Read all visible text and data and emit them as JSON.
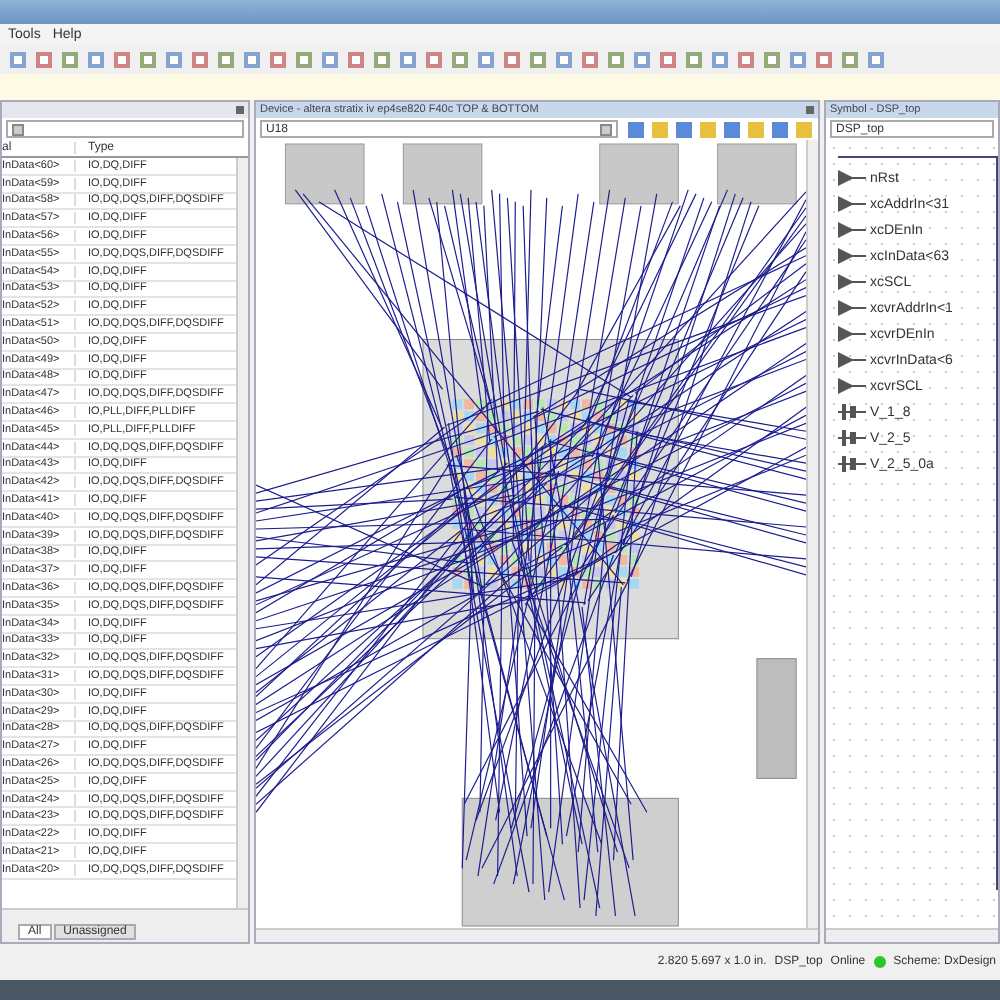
{
  "menu": [
    "Tools",
    "Help"
  ],
  "pin_panel": {
    "column_1": "al",
    "column_2": "Type",
    "tabs": [
      {
        "label": "All",
        "selected": true
      },
      {
        "label": "Unassigned",
        "selected": false
      }
    ],
    "rows": [
      {
        "signal": "InData<60>",
        "type": "IO,DQ,DIFF"
      },
      {
        "signal": "InData<59>",
        "type": "IO,DQ,DIFF"
      },
      {
        "signal": "InData<58>",
        "type": "IO,DQ,DQS,DIFF,DQSDIFF"
      },
      {
        "signal": "InData<57>",
        "type": "IO,DQ,DIFF"
      },
      {
        "signal": "InData<56>",
        "type": "IO,DQ,DIFF"
      },
      {
        "signal": "InData<55>",
        "type": "IO,DQ,DQS,DIFF,DQSDIFF"
      },
      {
        "signal": "InData<54>",
        "type": "IO,DQ,DIFF"
      },
      {
        "signal": "InData<53>",
        "type": "IO,DQ,DIFF"
      },
      {
        "signal": "InData<52>",
        "type": "IO,DQ,DIFF"
      },
      {
        "signal": "InData<51>",
        "type": "IO,DQ,DQS,DIFF,DQSDIFF"
      },
      {
        "signal": "InData<50>",
        "type": "IO,DQ,DIFF"
      },
      {
        "signal": "InData<49>",
        "type": "IO,DQ,DIFF"
      },
      {
        "signal": "InData<48>",
        "type": "IO,DQ,DIFF"
      },
      {
        "signal": "InData<47>",
        "type": "IO,DQ,DQS,DIFF,DQSDIFF"
      },
      {
        "signal": "InData<46>",
        "type": "IO,PLL,DIFF,PLLDIFF"
      },
      {
        "signal": "InData<45>",
        "type": "IO,PLL,DIFF,PLLDIFF"
      },
      {
        "signal": "InData<44>",
        "type": "IO,DQ,DQS,DIFF,DQSDIFF"
      },
      {
        "signal": "InData<43>",
        "type": "IO,DQ,DIFF"
      },
      {
        "signal": "InData<42>",
        "type": "IO,DQ,DQS,DIFF,DQSDIFF"
      },
      {
        "signal": "InData<41>",
        "type": "IO,DQ,DIFF"
      },
      {
        "signal": "InData<40>",
        "type": "IO,DQ,DQS,DIFF,DQSDIFF"
      },
      {
        "signal": "InData<39>",
        "type": "IO,DQ,DQS,DIFF,DQSDIFF"
      },
      {
        "signal": "InData<38>",
        "type": "IO,DQ,DIFF"
      },
      {
        "signal": "InData<37>",
        "type": "IO,DQ,DIFF"
      },
      {
        "signal": "InData<36>",
        "type": "IO,DQ,DQS,DIFF,DQSDIFF"
      },
      {
        "signal": "InData<35>",
        "type": "IO,DQ,DQS,DIFF,DQSDIFF"
      },
      {
        "signal": "InData<34>",
        "type": "IO,DQ,DIFF"
      },
      {
        "signal": "InData<33>",
        "type": "IO,DQ,DIFF"
      },
      {
        "signal": "InData<32>",
        "type": "IO,DQ,DQS,DIFF,DQSDIFF"
      },
      {
        "signal": "InData<31>",
        "type": "IO,DQ,DQS,DIFF,DQSDIFF"
      },
      {
        "signal": "InData<30>",
        "type": "IO,DQ,DIFF"
      },
      {
        "signal": "InData<29>",
        "type": "IO,DQ,DIFF"
      },
      {
        "signal": "InData<28>",
        "type": "IO,DQ,DQS,DIFF,DQSDIFF"
      },
      {
        "signal": "InData<27>",
        "type": "IO,DQ,DIFF"
      },
      {
        "signal": "InData<26>",
        "type": "IO,DQ,DQS,DIFF,DQSDIFF"
      },
      {
        "signal": "InData<25>",
        "type": "IO,DQ,DIFF"
      },
      {
        "signal": "InData<24>",
        "type": "IO,DQ,DQS,DIFF,DQSDIFF"
      },
      {
        "signal": "InData<23>",
        "type": "IO,DQ,DQS,DIFF,DQSDIFF"
      },
      {
        "signal": "InData<22>",
        "type": "IO,DQ,DIFF"
      },
      {
        "signal": "InData<21>",
        "type": "IO,DQ,DIFF"
      },
      {
        "signal": "InData<20>",
        "type": "IO,DQ,DQS,DIFF,DQSDIFF"
      }
    ]
  },
  "device_panel": {
    "title": "Device - altera   stratix iv   ep4se820   F40c   TOP & BOTTOM",
    "component": "U18"
  },
  "symbol_panel": {
    "title": "Symbol - DSP_top",
    "symbol": "DSP_top",
    "pins": [
      {
        "name": "nRst",
        "kind": "input"
      },
      {
        "name": "xcAddrIn<31",
        "kind": "input"
      },
      {
        "name": "xcDEnIn",
        "kind": "input"
      },
      {
        "name": "xcInData<63",
        "kind": "input"
      },
      {
        "name": "xcSCL",
        "kind": "input"
      },
      {
        "name": "xcvrAddrIn<1",
        "kind": "input"
      },
      {
        "name": "xcvrDEnIn",
        "kind": "input"
      },
      {
        "name": "xcvrInData<6",
        "kind": "input"
      },
      {
        "name": "xcvrSCL",
        "kind": "input"
      },
      {
        "name": "V_1_8",
        "kind": "power"
      },
      {
        "name": "V_2_5",
        "kind": "power"
      },
      {
        "name": "V_2_5_0a",
        "kind": "power"
      }
    ]
  },
  "status_bar": {
    "coordinates": "2.820 5.697 x 1.0 in.",
    "design": "DSP_top",
    "connection": "Online",
    "online": true,
    "scheme": "Scheme: DxDesign"
  }
}
